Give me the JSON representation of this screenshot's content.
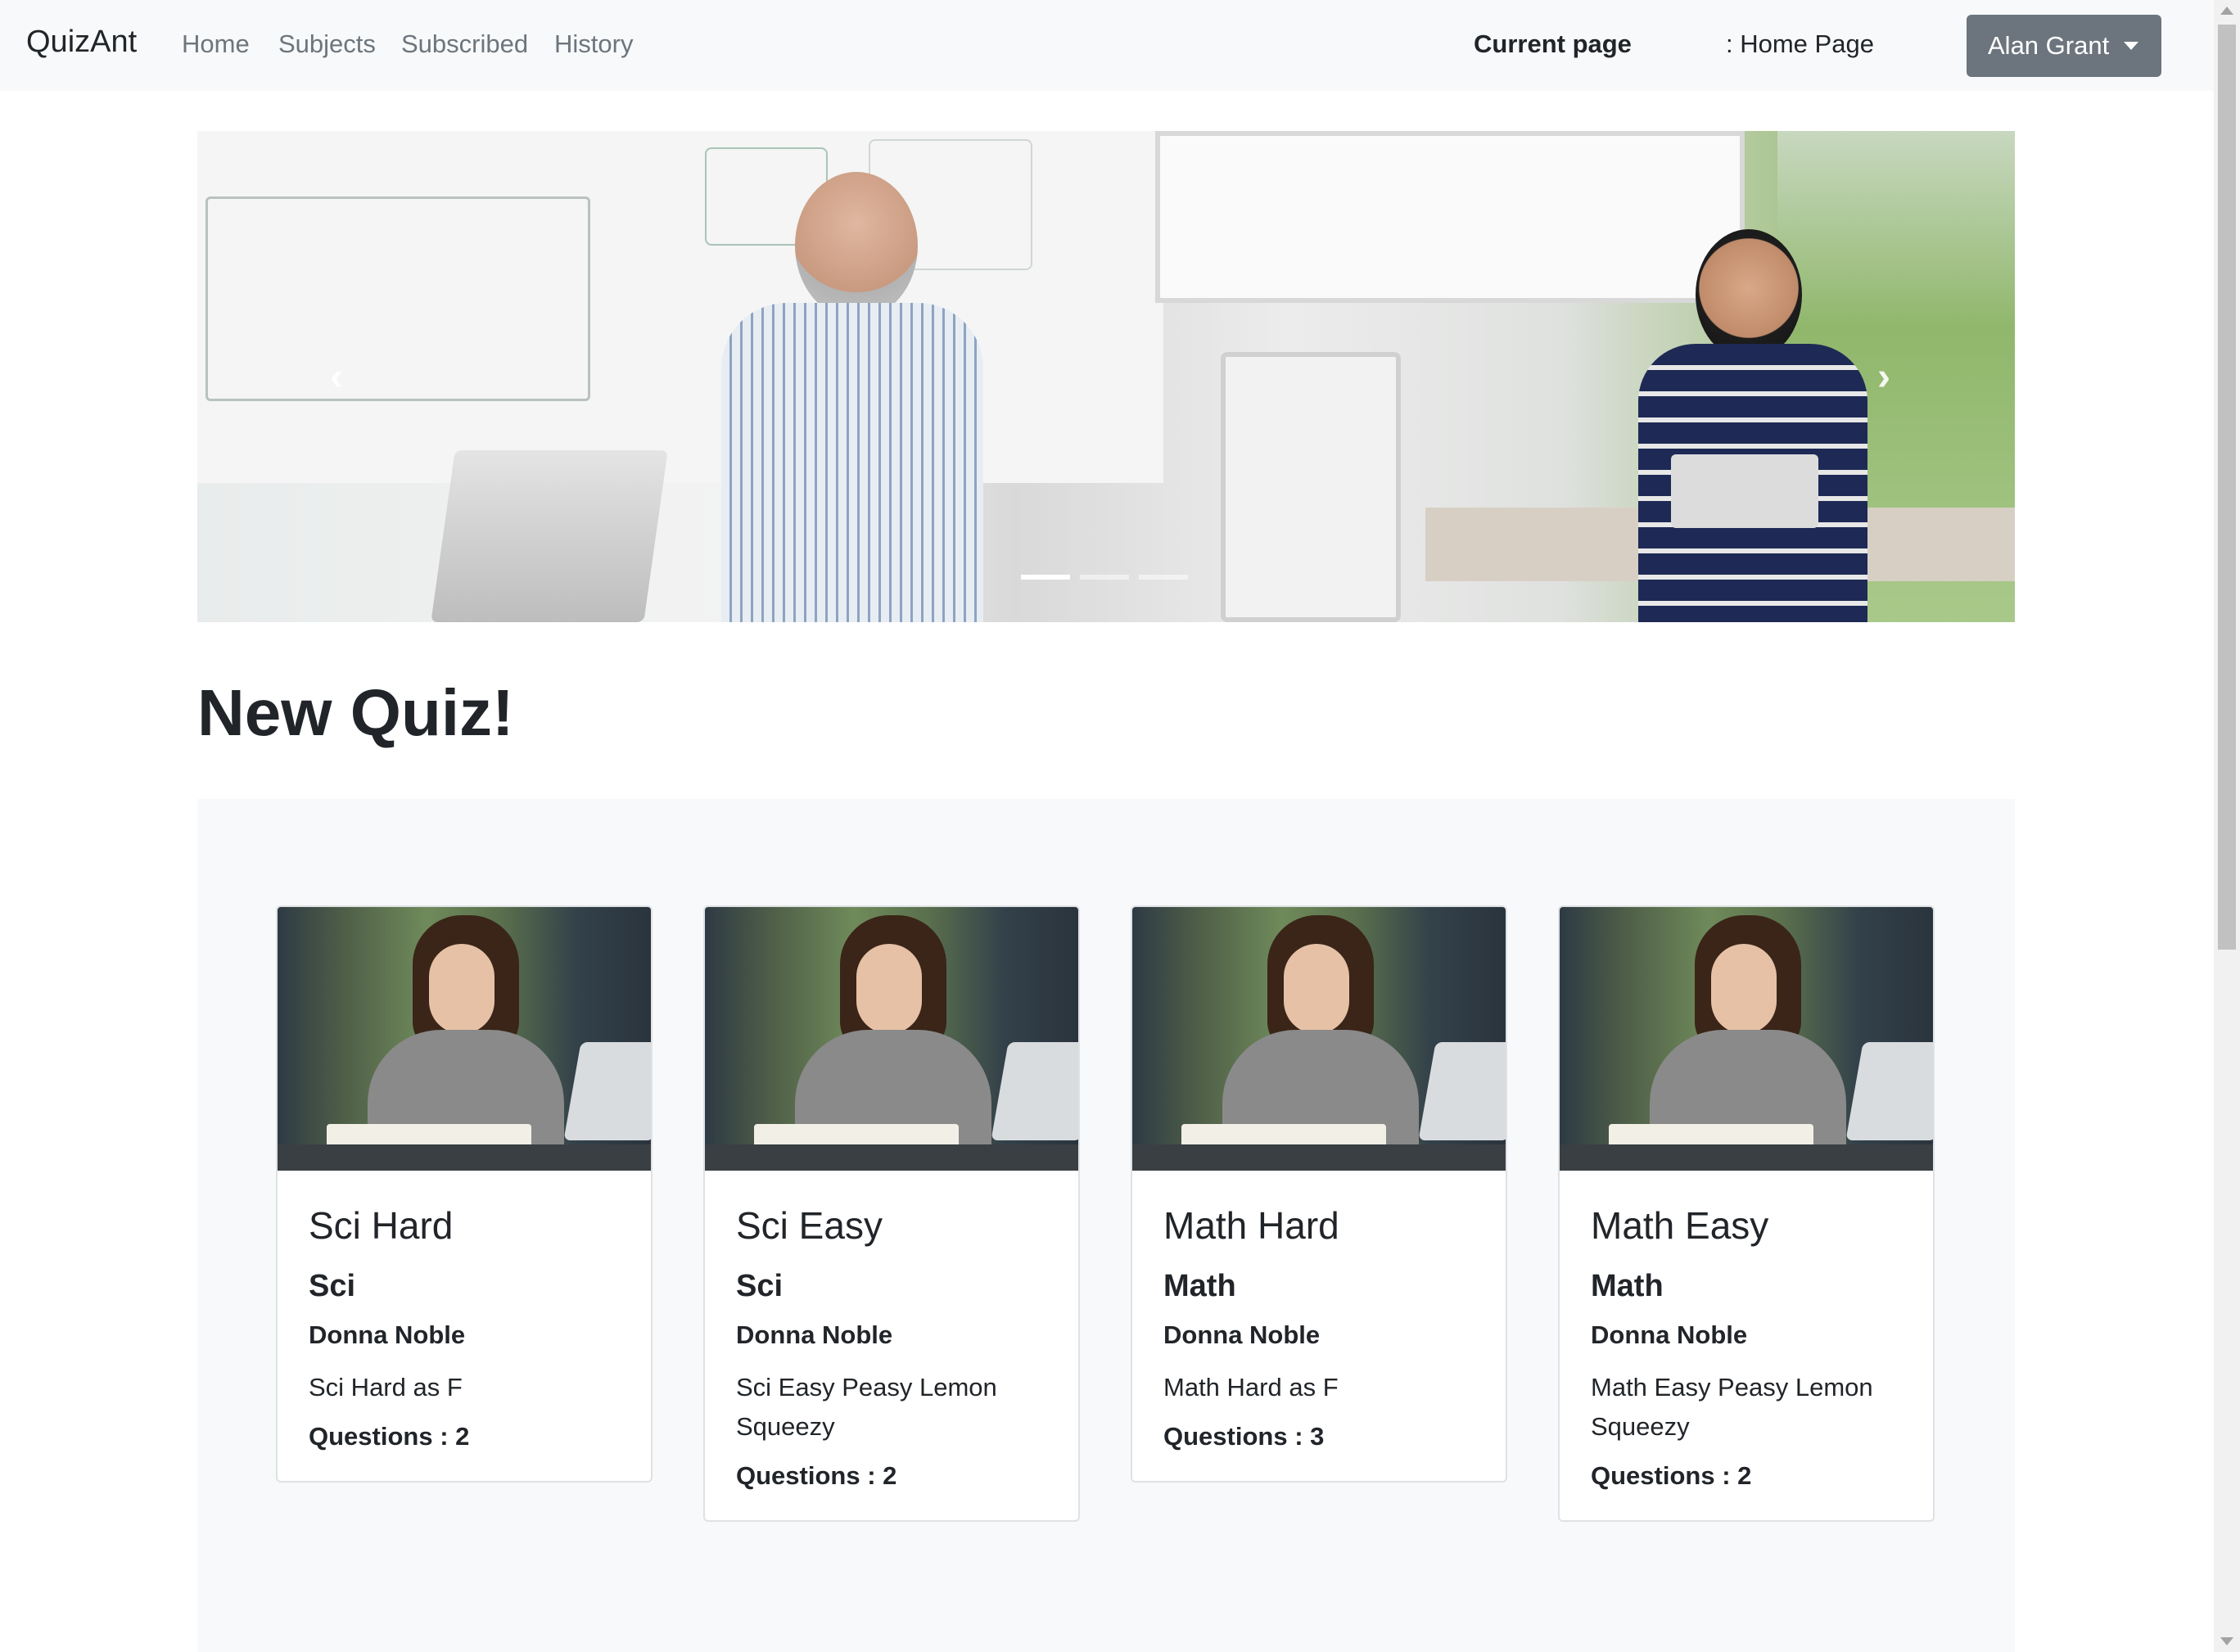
{
  "navbar": {
    "brand": "QuizAnt",
    "links": [
      "Home",
      "Subjects",
      "Subscribed",
      "History"
    ],
    "current_page_label": "Current page",
    "current_page_value": ": Home Page",
    "user_name": "Alan Grant"
  },
  "carousel": {
    "slides": 3,
    "active_slide": 1,
    "prev_icon": "chevron-left-icon",
    "next_icon": "chevron-right-icon"
  },
  "section": {
    "title": "New Quiz!"
  },
  "quizzes": [
    {
      "title": "Sci Hard",
      "subject": "Sci",
      "author": "Donna Noble",
      "description": "Sci Hard as F",
      "questions": "Questions : 2"
    },
    {
      "title": "Sci Easy",
      "subject": "Sci",
      "author": "Donna Noble",
      "description": "Sci Easy Peasy Lemon Squeezy",
      "questions": "Questions : 2"
    },
    {
      "title": "Math Hard",
      "subject": "Math",
      "author": "Donna Noble",
      "description": "Math Hard as F",
      "questions": "Questions : 3"
    },
    {
      "title": "Math Easy",
      "subject": "Math",
      "author": "Donna Noble",
      "description": "Math Easy Peasy Lemon Squeezy",
      "questions": "Questions : 2"
    }
  ],
  "colors": {
    "navbar_bg": "#f8f9fa",
    "user_button": "#6c757d",
    "nav_link": "#6c757d",
    "quiz_area_bg": "#f8f9fa"
  }
}
